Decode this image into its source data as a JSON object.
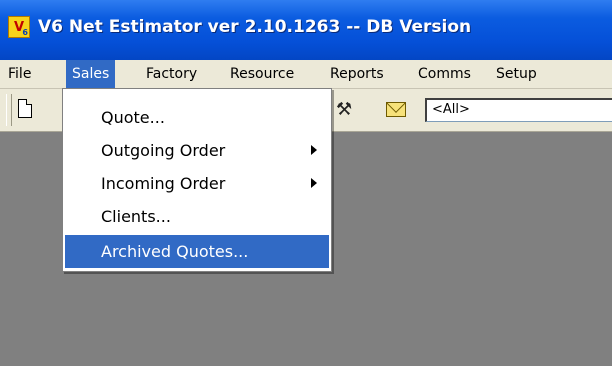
{
  "window": {
    "title": "V6 Net Estimator ver 2.10.1263 -- DB Version",
    "icon": "app-logo-icon",
    "icon_text": "V",
    "icon_subtext": "6"
  },
  "menubar": {
    "items": [
      {
        "label": "File"
      },
      {
        "label": "Sales",
        "active": true
      },
      {
        "label": "Factory"
      },
      {
        "label": "Resource"
      },
      {
        "label": "Reports"
      },
      {
        "label": "Comms"
      },
      {
        "label": "Setup"
      }
    ]
  },
  "toolbar": {
    "buttons": [
      "new-document-icon",
      "tool-icon",
      "mail-icon"
    ],
    "filter_value": "<All>"
  },
  "sales_menu": {
    "items": [
      {
        "label": "Quote..."
      },
      {
        "label": "Outgoing Order",
        "submenu": true
      },
      {
        "label": "Incoming Order",
        "submenu": true
      },
      {
        "label": "Clients..."
      },
      {
        "label": "Archived Quotes...",
        "highlighted": true
      }
    ]
  },
  "colors": {
    "titlebar": "#0550D8",
    "menu_highlight": "#316AC5",
    "chrome": "#ECE9D8",
    "workspace": "#808080"
  }
}
